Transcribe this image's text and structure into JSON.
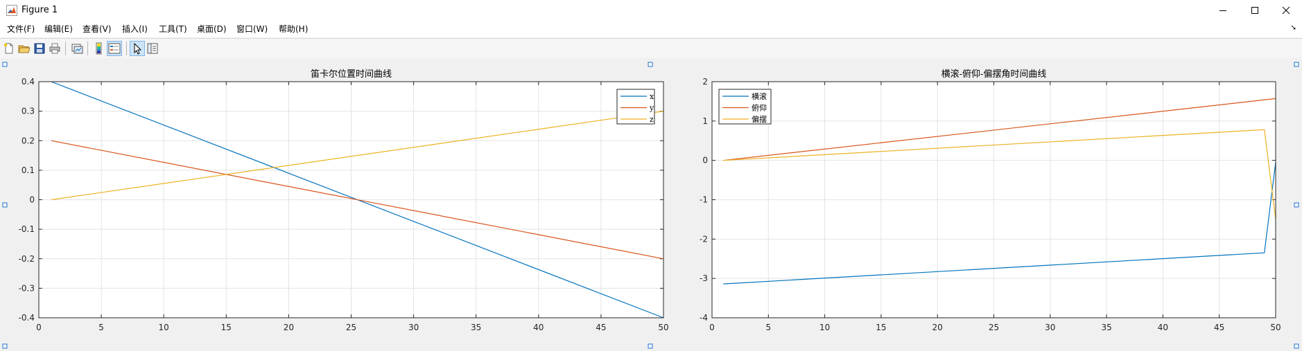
{
  "window": {
    "title": "Figure 1"
  },
  "menu": [
    "文件(F)",
    "编辑(E)",
    "查看(V)",
    "插入(I)",
    "工具(T)",
    "桌面(D)",
    "窗口(W)",
    "帮助(H)"
  ],
  "toolbar": {
    "buttons": [
      "new-figure",
      "open-file",
      "save",
      "print",
      "link-plot",
      "insert-colorbar",
      "insert-legend",
      "edit-plot",
      "property-inspector"
    ]
  },
  "colors": {
    "series1": "#0072BD",
    "series2": "#D95319",
    "series3": "#EDB120"
  },
  "chart_data": [
    {
      "type": "line",
      "title": "笛卡尔位置时间曲线",
      "xlim": [
        0,
        50
      ],
      "ylim": [
        -0.4,
        0.4
      ],
      "xticks": [
        "0",
        "5",
        "10",
        "15",
        "20",
        "25",
        "30",
        "35",
        "40",
        "45",
        "50"
      ],
      "yticks": [
        "-0.4",
        "-0.3",
        "-0.2",
        "-0.1",
        "0",
        "0.1",
        "0.2",
        "0.3",
        "0.4"
      ],
      "grid": true,
      "legend_position": "top-right",
      "series": [
        {
          "name": "x",
          "x": [
            1,
            50
          ],
          "y": [
            0.4,
            -0.4
          ]
        },
        {
          "name": "y",
          "x": [
            1,
            50
          ],
          "y": [
            0.2,
            -0.2
          ]
        },
        {
          "name": "z",
          "x": [
            1,
            50
          ],
          "y": [
            0.0,
            0.3
          ]
        }
      ]
    },
    {
      "type": "line",
      "title": "横滚-俯仰-偏摆角时间曲线",
      "xlim": [
        0,
        50
      ],
      "ylim": [
        -4,
        2
      ],
      "xticks": [
        "0",
        "5",
        "10",
        "15",
        "20",
        "25",
        "30",
        "35",
        "40",
        "45",
        "50"
      ],
      "yticks": [
        "-4",
        "-3",
        "-2",
        "-1",
        "0",
        "1",
        "2"
      ],
      "grid": true,
      "legend_position": "top-left",
      "series": [
        {
          "name": "横滚",
          "x": [
            1,
            49,
            50
          ],
          "y": [
            -3.14,
            -2.35,
            -0.05
          ]
        },
        {
          "name": "俯仰",
          "x": [
            1,
            50
          ],
          "y": [
            0.0,
            1.57
          ]
        },
        {
          "name": "偏摆",
          "x": [
            1,
            49,
            50
          ],
          "y": [
            0.0,
            0.78,
            -1.5
          ]
        }
      ]
    }
  ]
}
